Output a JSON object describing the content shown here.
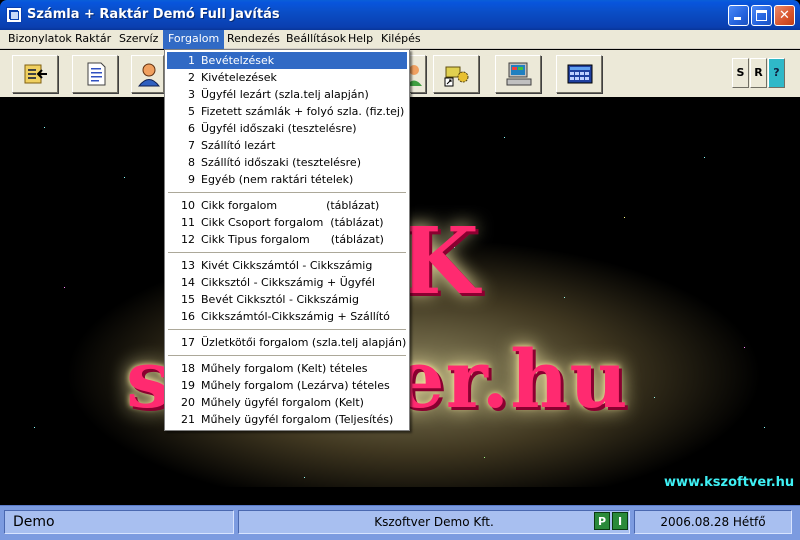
{
  "window": {
    "title": "Számla + Raktár Demó Full  Javítás"
  },
  "menubar": {
    "items": [
      "Bizonylatok",
      "Raktár",
      "Szervíz",
      "Forgalom",
      "Rendezés",
      "Beállítások",
      "Help",
      "Kilépés"
    ]
  },
  "toolbar": {
    "small_buttons": [
      "S",
      "R",
      "?"
    ]
  },
  "dropdown": {
    "items": [
      {
        "num": "1",
        "label": "Bevételzések"
      },
      {
        "num": "2",
        "label": "Kivételezések"
      },
      {
        "num": "3",
        "label": "Ügyfél lezárt (szla.telj alapján)"
      },
      {
        "num": "5",
        "label": "Fizetett számlák + folyó szla. (fiz.tej)"
      },
      {
        "num": "6",
        "label": "Ügyfél időszaki (tesztelésre)"
      },
      {
        "num": "7",
        "label": "Szállító lezárt"
      },
      {
        "num": "8",
        "label": "Szállító időszaki (tesztelésre)"
      },
      {
        "num": "9",
        "label": "Egyéb (nem raktári tételek)"
      },
      {
        "num": "10",
        "label": "Cikk forgalom              (táblázat)"
      },
      {
        "num": "11",
        "label": "Cikk Csoport forgalom  (táblázat)"
      },
      {
        "num": "12",
        "label": "Cikk Tipus forgalom      (táblázat)"
      },
      {
        "num": "13",
        "label": "Kivét Cikkszámtól - Cikkszámig"
      },
      {
        "num": "14",
        "label": "Cikksztól - Cikkszámig + Ügyfél"
      },
      {
        "num": "15",
        "label": "Bevét Cikksztól - Cikkszámig"
      },
      {
        "num": "16",
        "label": "Cikkszámtól-Cikkszámig + Szállító"
      },
      {
        "num": "17",
        "label": "Üzletkötői forgalom (szla.telj alapján)"
      },
      {
        "num": "18",
        "label": "Műhely forgalom (Kelt) tételes"
      },
      {
        "num": "19",
        "label": "Műhely forgalom (Lezárva) tételes"
      },
      {
        "num": "20",
        "label": "Műhely ügyfél forgalom (Kelt)"
      },
      {
        "num": "21",
        "label": "Műhely ügyfél forgalom (Teljesítés)"
      }
    ]
  },
  "main": {
    "logo_k": "K",
    "logo_text": "szoftver.hu",
    "site_url": "www.kszoftver.hu"
  },
  "statusbar": {
    "left": "Demo",
    "center": "Kszoftver Demo Kft.",
    "badge_p": "P",
    "badge_i": "I",
    "date": "2006.08.28 Hétfő"
  },
  "colors": {
    "menu_highlight": "#316ac5",
    "logo_pink": "#ff2a70",
    "url_cyan": "#3ff0f4",
    "status_bg": "#7c9be0"
  }
}
